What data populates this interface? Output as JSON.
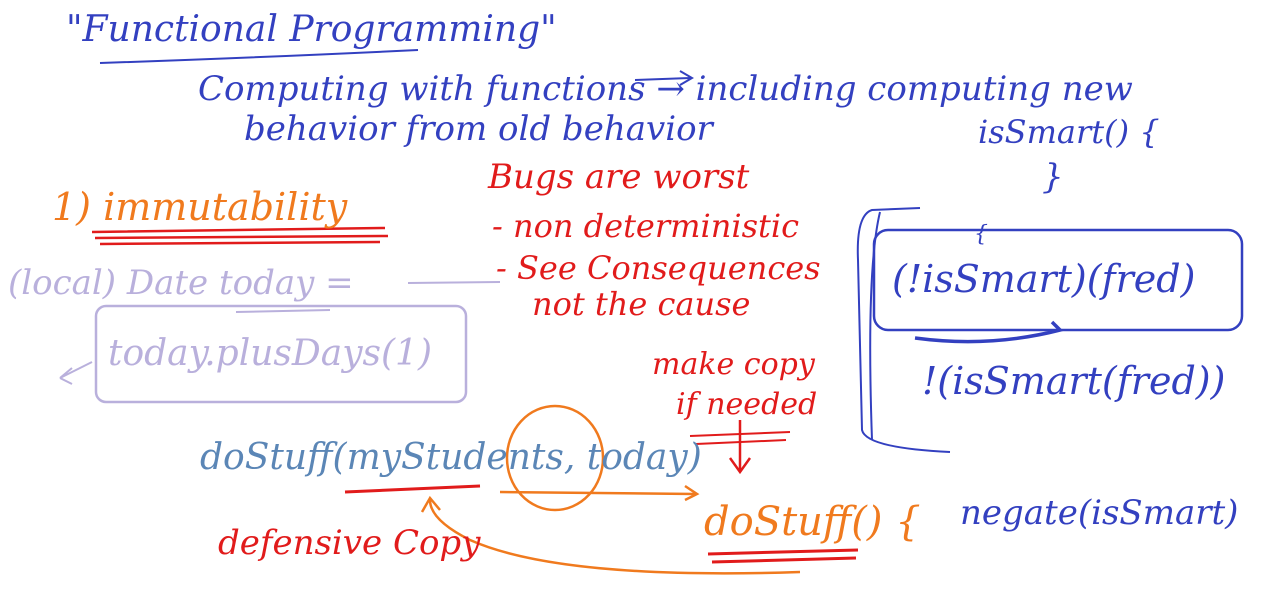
{
  "board": {
    "title": "\"Functional Programming\"",
    "subtitle_line1": "Computing with functions → including computing new",
    "subtitle_line2": "behavior from old behavior",
    "point1": "1) immutability",
    "bugs_title": "Bugs are worst",
    "bugs_item1": "- non deterministic",
    "bugs_item2": "- See Consequences",
    "bugs_item3": "not the cause",
    "code_line1": "(local) Date today =",
    "code_line2": "today.plusDays(1)",
    "call_line": "doStuff(myStudents, today)",
    "make_copy": "make copy",
    "if_needed": "if needed",
    "callee": "doStuff() {",
    "defensive_copy": "defensive Copy",
    "is_smart_decl": "isSmart() {",
    "brace_close": "}",
    "brace_open_small": "{",
    "not_is_smart": "(!isSmart)(fred)",
    "not_is_smart_fred": "!(isSmart(fred))",
    "negate": "negate(isSmart)",
    "colors": {
      "blue": "#3340c0",
      "orange": "#f07a1e",
      "red": "#e11b1b",
      "steel": "#5b86b6",
      "lilac": "#b9b0dc"
    }
  }
}
